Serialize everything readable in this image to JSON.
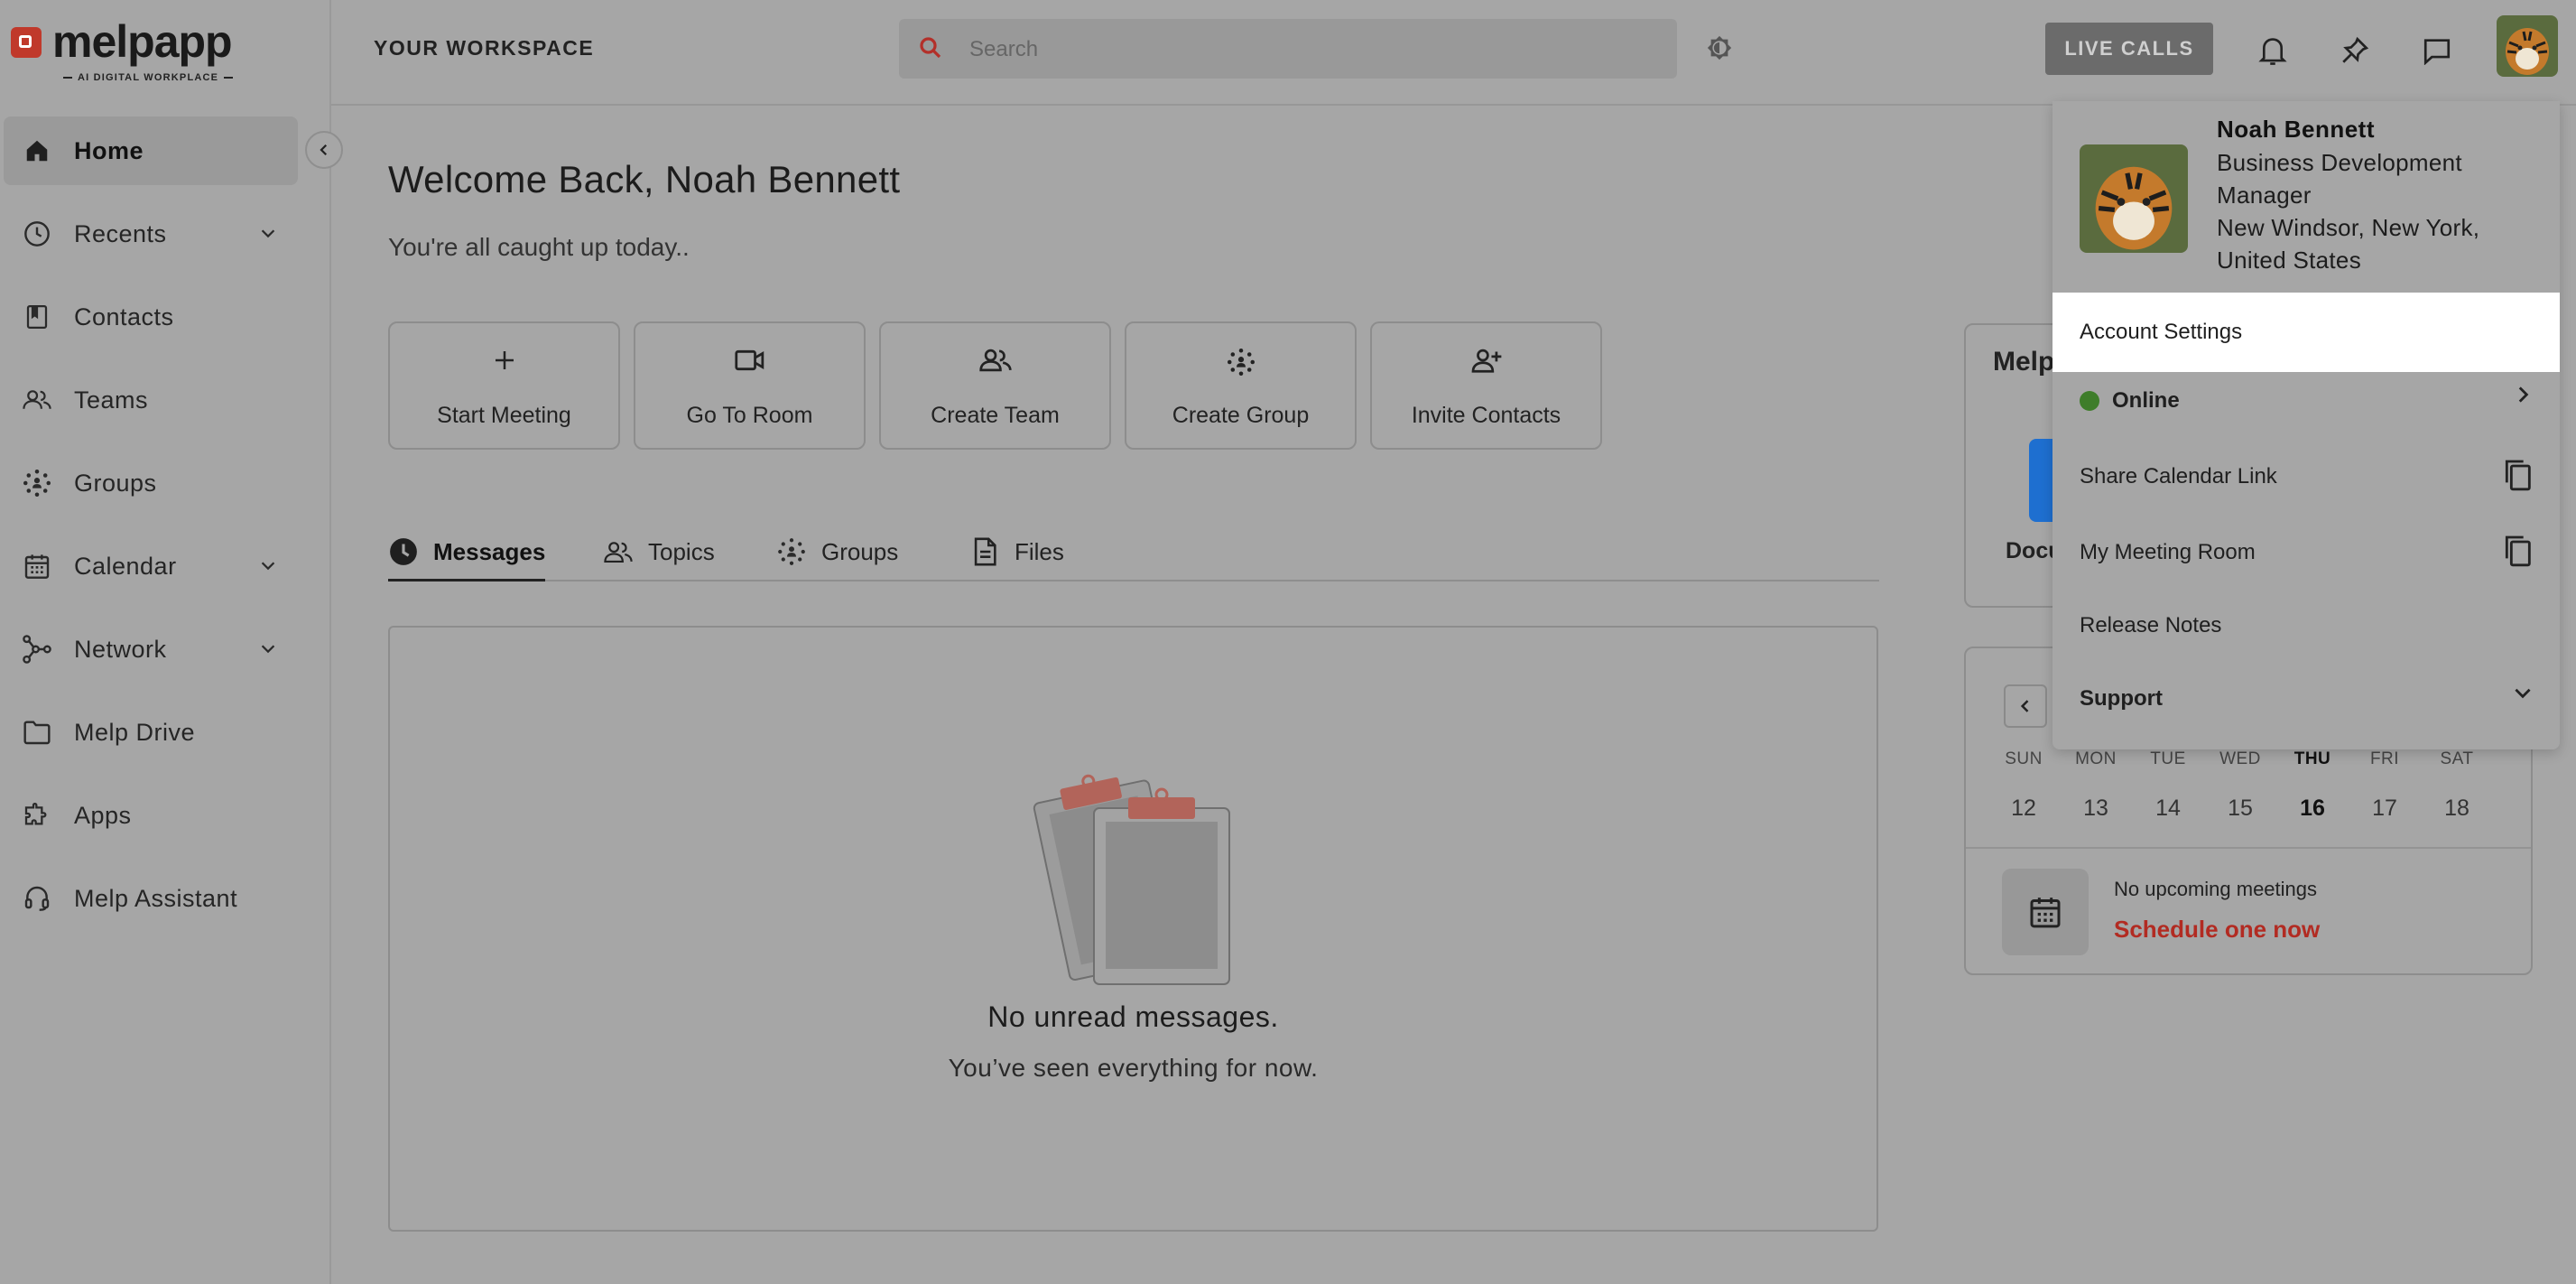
{
  "app": {
    "logo_text": "melpapp",
    "logo_tagline": "AI DIGITAL WORKPLACE"
  },
  "sidebar": {
    "items": [
      {
        "label": "Home",
        "icon": "home-icon",
        "active": true
      },
      {
        "label": "Recents",
        "icon": "clock-icon",
        "expandable": true
      },
      {
        "label": "Contacts",
        "icon": "contacts-book-icon"
      },
      {
        "label": "Teams",
        "icon": "teams-icon"
      },
      {
        "label": "Groups",
        "icon": "groups-icon"
      },
      {
        "label": "Calendar",
        "icon": "calendar-icon",
        "expandable": true
      },
      {
        "label": "Network",
        "icon": "network-icon",
        "expandable": true
      },
      {
        "label": "Melp Drive",
        "icon": "folder-icon"
      },
      {
        "label": "Apps",
        "icon": "puzzle-icon"
      },
      {
        "label": "Melp Assistant",
        "icon": "headset-icon"
      }
    ]
  },
  "header": {
    "workspace_label": "YOUR WORKSPACE",
    "search_placeholder": "Search",
    "live_calls_label": "LIVE CALLS"
  },
  "main": {
    "welcome": "Welcome Back, Noah Bennett",
    "subtitle": "You're all caught up today..",
    "quick_actions": [
      {
        "label": "Start Meeting",
        "icon": "plus-icon"
      },
      {
        "label": "Go To Room",
        "icon": "video-icon"
      },
      {
        "label": "Create Team",
        "icon": "team-icon"
      },
      {
        "label": "Create Group",
        "icon": "group-icon"
      },
      {
        "label": "Invite Contacts",
        "icon": "add-user-icon"
      }
    ],
    "tabs": [
      {
        "label": "Messages",
        "icon": "clock-filled-icon",
        "active": true
      },
      {
        "label": "Topics",
        "icon": "topics-icon"
      },
      {
        "label": "Groups",
        "icon": "groups-icon"
      },
      {
        "label": "Files",
        "icon": "file-icon"
      }
    ],
    "empty_state": {
      "title": "No unread messages.",
      "subtitle": "You’ve seen everything for now."
    }
  },
  "right_panel": {
    "melp_card_title": "Melp",
    "melp_card_item": "Docu",
    "calendar": {
      "weekdays": [
        "SUN",
        "MON",
        "TUE",
        "WED",
        "THU",
        "FRI",
        "SAT"
      ],
      "dates": [
        "12",
        "13",
        "14",
        "15",
        "16",
        "17",
        "18"
      ],
      "today_index": 4,
      "no_meetings": "No upcoming meetings",
      "schedule_link": "Schedule one now"
    }
  },
  "profile_menu": {
    "name": "Noah Bennett",
    "title": "Business Development Manager",
    "location": "New Windsor, New York, United States",
    "items": {
      "account_settings": "Account Settings",
      "status": "Online",
      "share_calendar": "Share Calendar Link",
      "meeting_room": "My Meeting Room",
      "release_notes": "Release Notes",
      "support": "Support"
    }
  },
  "colors": {
    "accent_red": "#c0392b",
    "status_online": "#3e7d2a",
    "link_red": "#b22b22",
    "highlight": "#ffffff"
  }
}
